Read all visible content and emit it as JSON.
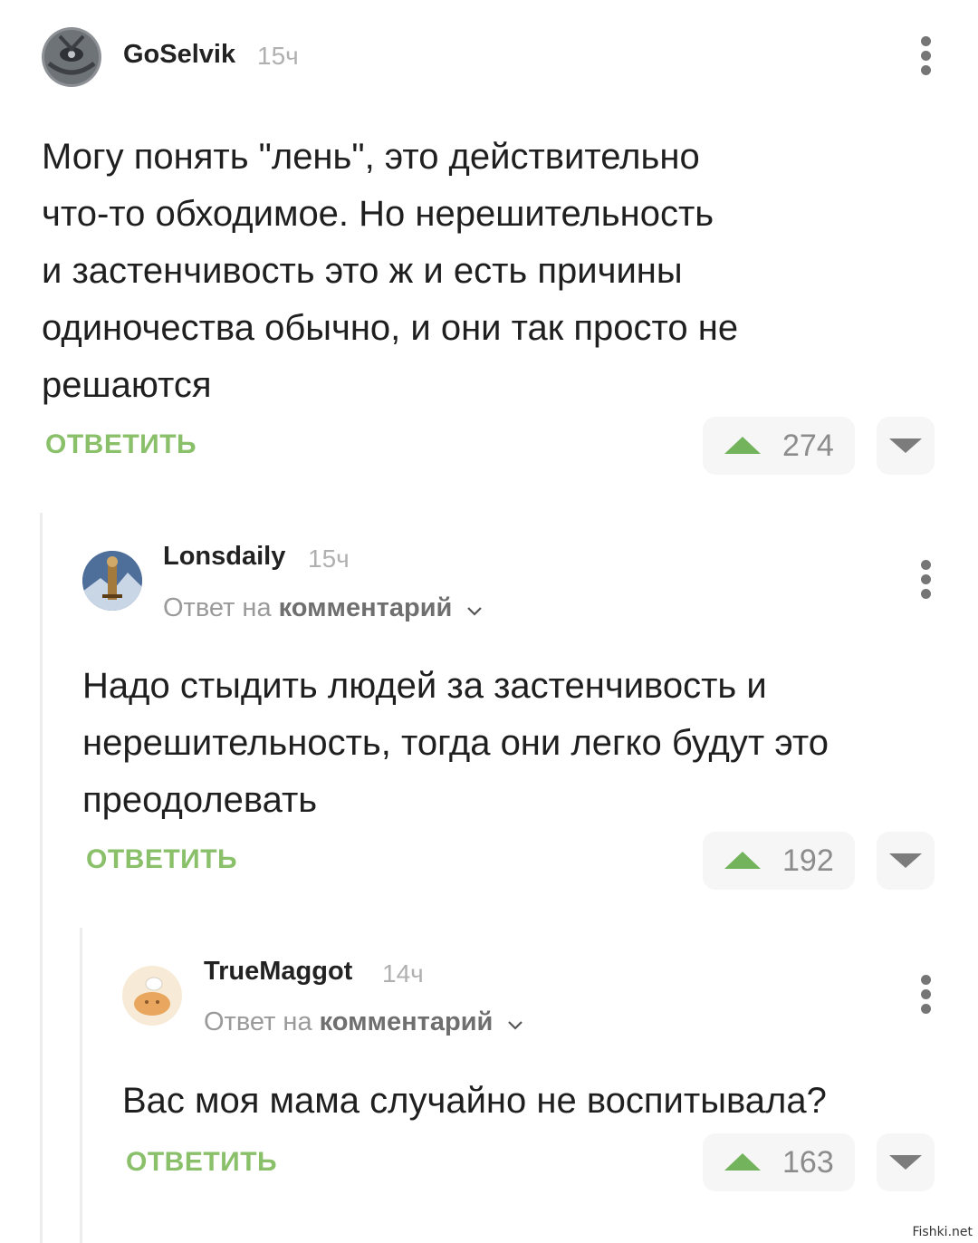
{
  "comments": [
    {
      "username": "GoSelvik",
      "time": "15ч",
      "text": "Могу понять \"лень\", это действительно\nчто-то обходимое. Но нерешительность\nи застенчивость это ж и есть причины\nодиночества обычно, и они так просто не\nрешаются",
      "reply_label": "ОТВЕТИТЬ",
      "votes": "274"
    },
    {
      "username": "Lonsdaily",
      "time": "15ч",
      "reply_prefix": "Ответ на",
      "reply_target": "комментарий",
      "text": "Надо стыдить людей за застенчивость и\nнерешительность, тогда они легко будут это\nпреодолевать",
      "reply_label": "ОТВЕТИТЬ",
      "votes": "192"
    },
    {
      "username": "TrueMaggot",
      "time": "14ч",
      "reply_prefix": "Ответ на",
      "reply_target": "комментарий",
      "text": "Вас моя мама случайно не воспитывала?",
      "reply_label": "ОТВЕТИТЬ",
      "votes": "163"
    }
  ],
  "watermark": "Fishki.net",
  "colors": {
    "accent_green": "#8ac06a",
    "upvote_green": "#73b35c",
    "muted_gray": "#9a9a9a"
  },
  "icons": {
    "more": "kebab-menu-icon",
    "upvote": "upvote-triangle-icon",
    "downvote": "downvote-triangle-icon",
    "expand": "chevron-down-icon"
  }
}
